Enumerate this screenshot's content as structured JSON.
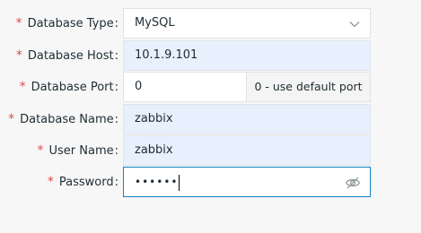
{
  "form": {
    "database_type": {
      "label": "Database Type",
      "required_mark": "*",
      "colon": ":",
      "value": "MySQL",
      "chevron_icon": "chevron-down-icon"
    },
    "database_host": {
      "label": "Database Host",
      "required_mark": "*",
      "colon": ":",
      "value": "10.1.9.101"
    },
    "database_port": {
      "label": "Database Port",
      "required_mark": "*",
      "colon": ":",
      "value": "0",
      "hint": "0 - use default port"
    },
    "database_name": {
      "label": "Database Name",
      "required_mark": "*",
      "colon": ":",
      "value": "zabbix"
    },
    "user_name": {
      "label": "User Name",
      "required_mark": "*",
      "colon": ":",
      "value": "zabbix"
    },
    "password": {
      "label": "Password",
      "required_mark": "*",
      "colon": ":",
      "masked_value": "••••••",
      "toggle_icon": "eye-off-icon"
    }
  },
  "colors": {
    "required": "#d64e4e",
    "focus_border": "#0d86c3",
    "autofill_bg": "#e8f0fe"
  }
}
